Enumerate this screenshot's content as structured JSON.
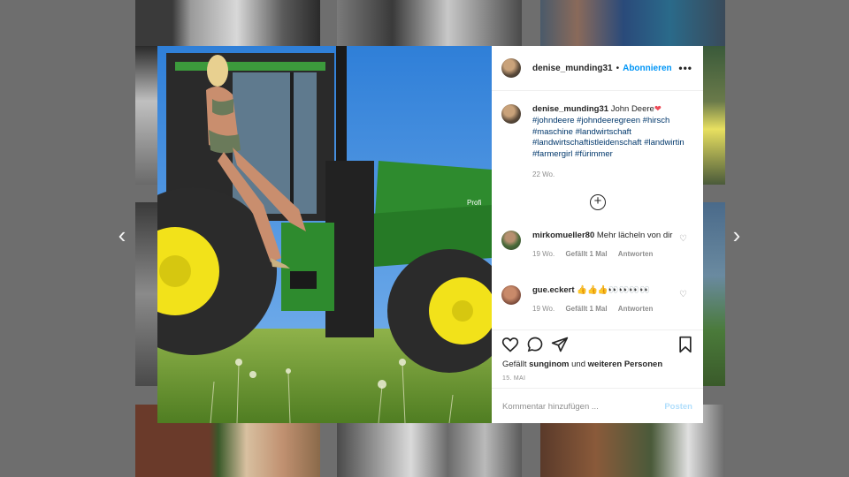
{
  "post": {
    "username": "denise_munding31",
    "separator": "•",
    "follow_label": "Abonnieren",
    "more_label": "•••",
    "caption_user": "denise_munding31",
    "caption_text": "John Deere",
    "caption_emoji": "❤",
    "hashtags": "#johndeere #johndeeregreen #hirsch #maschine #landwirtschaft #landwirtschaftistleidenschaft #landwirtin #farmergirl #fürimmer",
    "age": "22 Wo.",
    "load_more": "+",
    "likes_prefix": "Gefällt",
    "likes_user": "sunginom",
    "likes_mid": "und",
    "likes_suffix": "weiteren Personen",
    "date": "15. MAI",
    "comment_placeholder": "Kommentar hinzufügen ...",
    "post_label": "Posten"
  },
  "comments": [
    {
      "user": "mirkomueller80",
      "text": "Mehr lächeln von dir",
      "age": "19 Wo.",
      "likes": "Gefällt 1 Mal",
      "reply": "Antworten"
    },
    {
      "user": "gue.eckert",
      "text": "👍👍👍👀👀👀👀",
      "age": "19 Wo.",
      "likes": "Gefällt 1 Mal",
      "reply": "Antworten"
    }
  ],
  "nav": {
    "prev": "‹",
    "next": "›"
  },
  "photo_text": {
    "loader_brand": "Profi"
  },
  "colors": {
    "link": "#0095f6",
    "hashtag": "#00376b",
    "tractor_green": "#2e8b2e",
    "rim_yellow": "#f2e21a"
  },
  "icons": [
    "heart-icon",
    "comment-icon",
    "share-icon",
    "bookmark-icon",
    "plus-circle-icon",
    "chevron-left-icon",
    "chevron-right-icon",
    "more-icon"
  ]
}
